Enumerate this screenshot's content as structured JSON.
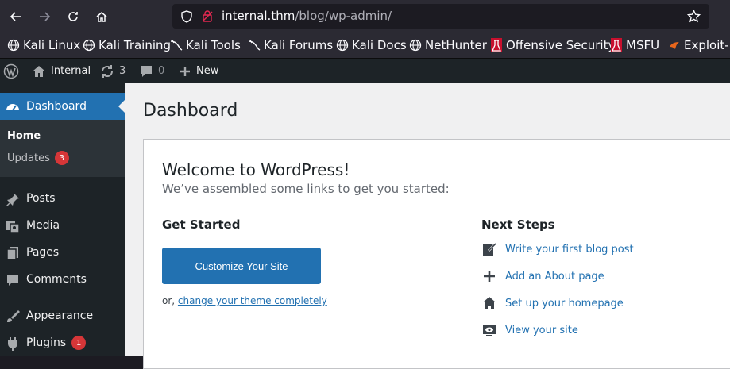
{
  "browser": {
    "url_host": "internal.thm",
    "url_path": "/blog/wp-admin/"
  },
  "bookmarks": [
    {
      "label": "Kali Linux",
      "icon": "globe-icon"
    },
    {
      "label": "Kali Training",
      "icon": "globe-icon"
    },
    {
      "label": "Kali Tools",
      "icon": "kali-dragon-icon"
    },
    {
      "label": "Kali Forums",
      "icon": "kali-dragon-icon"
    },
    {
      "label": "Kali Docs",
      "icon": "globe-icon"
    },
    {
      "label": "NetHunter",
      "icon": "globe-icon"
    },
    {
      "label": "Offensive Security",
      "icon": "offsec-icon"
    },
    {
      "label": "MSFU",
      "icon": "offsec-icon"
    },
    {
      "label": "Exploit-D",
      "icon": "exploit-db-icon"
    }
  ],
  "adminbar": {
    "site_name": "Internal",
    "updates_count": "3",
    "comments_count": "0",
    "new_label": "New"
  },
  "sidebar": {
    "dashboard": "Dashboard",
    "home": "Home",
    "updates": "Updates",
    "updates_badge": "3",
    "items": [
      {
        "label": "Posts",
        "icon": "pushpin-icon"
      },
      {
        "label": "Media",
        "icon": "media-icon"
      },
      {
        "label": "Pages",
        "icon": "pages-icon"
      },
      {
        "label": "Comments",
        "icon": "comment-icon"
      },
      {
        "label": "Appearance",
        "icon": "paintbrush-icon"
      },
      {
        "label": "Plugins",
        "icon": "plugin-icon",
        "badge": "1"
      }
    ]
  },
  "main": {
    "page_title": "Dashboard",
    "welcome_title": "Welcome to WordPress!",
    "welcome_about": "We’ve assembled some links to get you started:",
    "get_started": "Get Started",
    "customize_button": "Customize Your Site",
    "or_text": "or,",
    "change_theme_link": "change your theme completely",
    "next_steps": "Next Steps",
    "steps": [
      {
        "label": "Write your first blog post",
        "icon": "edit-icon"
      },
      {
        "label": "Add an About page",
        "icon": "plus-icon"
      },
      {
        "label": "Set up your homepage",
        "icon": "home-icon"
      },
      {
        "label": "View your site",
        "icon": "view-icon"
      }
    ]
  },
  "colors": {
    "admin_bar": "#1d2327",
    "accent": "#2271b1",
    "badge": "#d63638"
  }
}
